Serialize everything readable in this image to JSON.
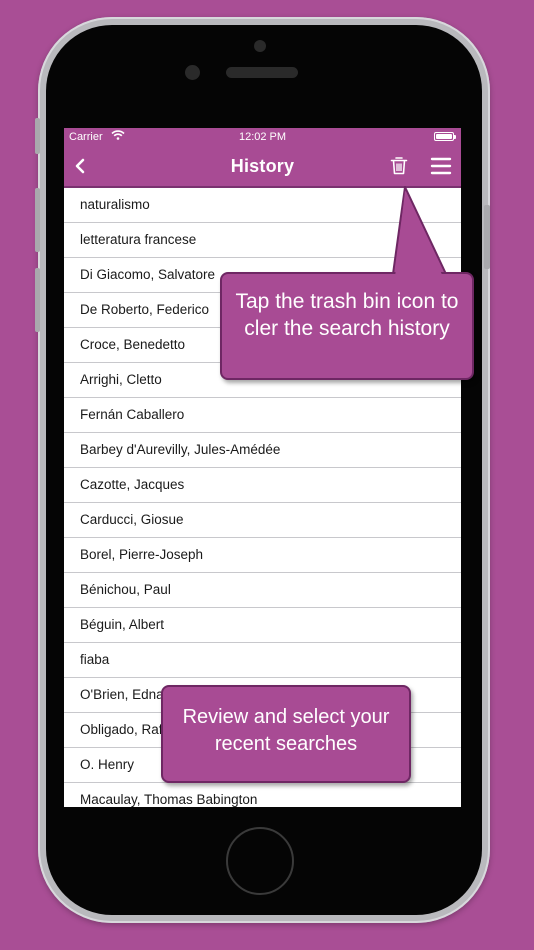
{
  "status_bar": {
    "carrier": "Carrier",
    "time": "12:02 PM"
  },
  "nav": {
    "title": "History",
    "back_icon": "chevron-left-icon",
    "trash_icon": "trash-icon",
    "menu_icon": "hamburger-menu-icon"
  },
  "history": [
    "naturalismo",
    "letteratura francese",
    "Di Giacomo, Salvatore",
    "De Roberto, Federico",
    "Croce, Benedetto",
    "Arrighi, Cletto",
    "Fernán Caballero",
    "Barbey d'Aurevilly, Jules-Amédée",
    "Cazotte, Jacques",
    "Carducci, Giosue",
    "Borel, Pierre-Joseph",
    "Bénichou, Paul",
    "Béguin, Albert",
    "fiaba",
    "O'Brien, Edna",
    "Obligado, Rafael",
    "O. Henry",
    "Macaulay, Thomas Babington"
  ],
  "callouts": {
    "trash": "Tap the trash bin icon to cler the search history",
    "recent": "Review and select your recent searches"
  },
  "colors": {
    "background": "#a94e95",
    "accent": "#a84b94"
  }
}
